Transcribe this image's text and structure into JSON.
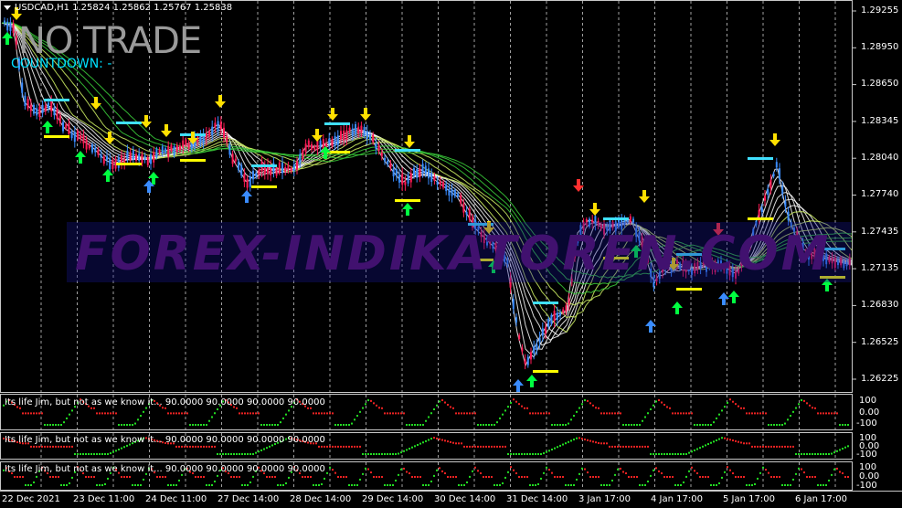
{
  "chart_header": {
    "symbol_line": "USDCAD,H1  1.25824 1.25862 1.25767 1.25838",
    "signal_text": "NO TRADE",
    "countdown_text": "COUNTDOWN: -"
  },
  "watermark": "FOREX-INDIKATOREN.COM",
  "price_axis": [
    "1.29255",
    "1.28950",
    "1.28650",
    "1.28345",
    "1.28040",
    "1.27740",
    "1.27435",
    "1.27135",
    "1.26830",
    "1.26525",
    "1.26225"
  ],
  "time_axis": [
    "22 Dec 2021",
    "23 Dec 11:00",
    "24 Dec 11:00",
    "27 Dec 14:00",
    "28 Dec 14:00",
    "29 Dec 14:00",
    "30 Dec 14:00",
    "31 Dec 14:00",
    "3 Jan 17:00",
    "4 Jan 17:00",
    "5 Jan 17:00",
    "6 Jan 17:00"
  ],
  "indicators": [
    {
      "label": "Its life Jim, but not as we know it...  90.0000 90.0000 90.0000 90.0000",
      "scale": [
        "100",
        "0.00",
        "-100"
      ]
    },
    {
      "label": "Its life Jim, but not as we know it...  90.0000 90.0000 90.0000 90.0000",
      "scale": [
        "100",
        "0.00",
        "-100"
      ]
    },
    {
      "label": "Its life Jim, but not as we know it...  90.0000 90.0000 90.0000 90.0000",
      "scale": [
        "100",
        "0.00",
        "-100"
      ]
    }
  ],
  "colors": {
    "background": "#000000",
    "grid": "#c8c8c8",
    "bull_candle": "#3a8cff",
    "bear_candle": "#ff1a55",
    "up_arrow": "#00ff40",
    "down_arrow": "#ffe000",
    "level_cyan": "#40e0ff",
    "level_yellow": "#ffff00",
    "ribbon_green": "#38c838",
    "ribbon_white": "#ffffff",
    "osc_up": "#22dd22",
    "osc_down": "#ee2222"
  },
  "icons": {
    "header_menu": "triangle-down-icon"
  }
}
